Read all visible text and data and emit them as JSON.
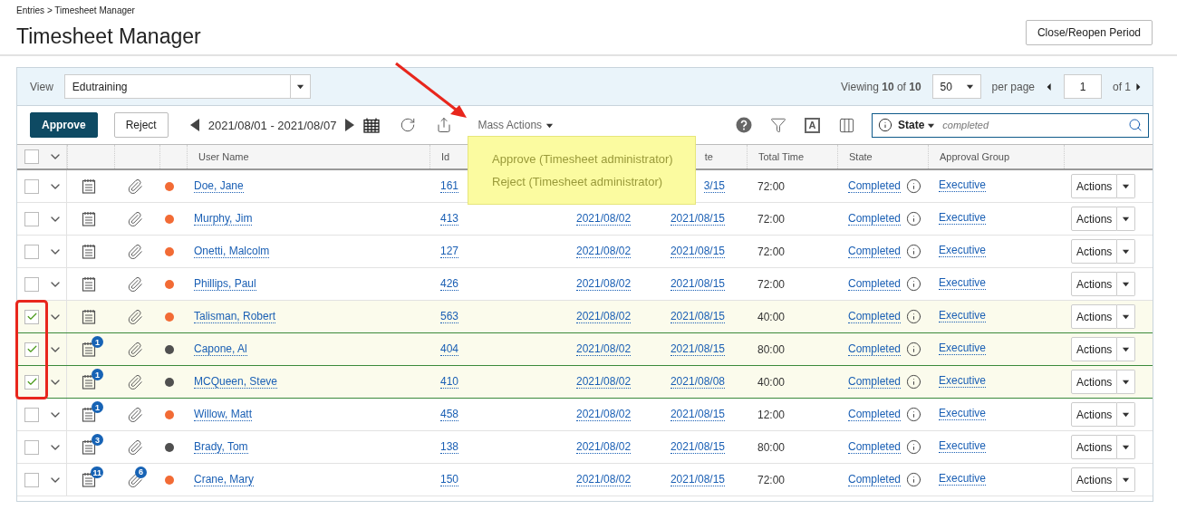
{
  "breadcrumb": "Entries > Timesheet Manager",
  "title": "Timesheet Manager",
  "close_button": "Close/Reopen Period",
  "view": {
    "label": "View",
    "value": "Edutraining"
  },
  "paging": {
    "viewing": "Viewing **10** of **10**",
    "page_size": "50",
    "per_page": "per page",
    "page": "1",
    "of": "of 1"
  },
  "toolbar": {
    "approve": "Approve",
    "reject": "Reject",
    "date_range": "2021/08/01 - 2021/08/07",
    "mass_actions": "Mass Actions",
    "text_icon": "A"
  },
  "search": {
    "field": "State",
    "placeholder": "completed"
  },
  "mass_actions_menu": [
    "Approve (Timesheet administrator)",
    "Reject (Timesheet administrator)"
  ],
  "select_all": {
    "checked": false
  },
  "columns": [
    "User Name",
    "Id",
    "",
    "te",
    "Total Time",
    "State",
    "Approval Group"
  ],
  "rows": [
    {
      "checked": false,
      "notes_badge": "",
      "attach_badge": "",
      "color": "#f26b35",
      "user": "Doe, Jane",
      "id": "161",
      "start": "",
      "end": "3/15",
      "total": "72:00",
      "state": "Completed",
      "group": "Executive",
      "actions": "Actions"
    },
    {
      "checked": false,
      "notes_badge": "",
      "attach_badge": "",
      "color": "#f26b35",
      "user": "Murphy, Jim",
      "id": "413",
      "start": "2021/08/02",
      "end": "2021/08/15",
      "total": "72:00",
      "state": "Completed",
      "group": "Executive",
      "actions": "Actions"
    },
    {
      "checked": false,
      "notes_badge": "",
      "attach_badge": "",
      "color": "#f26b35",
      "user": "Onetti, Malcolm",
      "id": "127",
      "start": "2021/08/02",
      "end": "2021/08/15",
      "total": "72:00",
      "state": "Completed",
      "group": "Executive",
      "actions": "Actions"
    },
    {
      "checked": false,
      "notes_badge": "",
      "attach_badge": "",
      "color": "#f26b35",
      "user": "Phillips, Paul",
      "id": "426",
      "start": "2021/08/02",
      "end": "2021/08/15",
      "total": "72:00",
      "state": "Completed",
      "group": "Executive",
      "actions": "Actions"
    },
    {
      "checked": true,
      "notes_badge": "",
      "attach_badge": "",
      "color": "#f26b35",
      "user": "Talisman, Robert",
      "id": "563",
      "start": "2021/08/02",
      "end": "2021/08/15",
      "total": "40:00",
      "state": "Completed",
      "group": "Executive",
      "actions": "Actions"
    },
    {
      "checked": true,
      "notes_badge": "1",
      "attach_badge": "",
      "color": "#505050",
      "user": "Capone, Al",
      "id": "404",
      "start": "2021/08/02",
      "end": "2021/08/15",
      "total": "80:00",
      "state": "Completed",
      "group": "Executive",
      "actions": "Actions"
    },
    {
      "checked": true,
      "notes_badge": "1",
      "attach_badge": "",
      "color": "#505050",
      "user": "MCQueen, Steve",
      "id": "410",
      "start": "2021/08/02",
      "end": "2021/08/08",
      "total": "40:00",
      "state": "Completed",
      "group": "Executive",
      "actions": "Actions"
    },
    {
      "checked": false,
      "notes_badge": "1",
      "attach_badge": "",
      "color": "#f26b35",
      "user": "Willow, Matt",
      "id": "458",
      "start": "2021/08/02",
      "end": "2021/08/15",
      "total": "12:00",
      "state": "Completed",
      "group": "Executive",
      "actions": "Actions"
    },
    {
      "checked": false,
      "notes_badge": "3",
      "attach_badge": "",
      "color": "#505050",
      "user": "Brady, Tom",
      "id": "138",
      "start": "2021/08/02",
      "end": "2021/08/15",
      "total": "80:00",
      "state": "Completed",
      "group": "Executive",
      "actions": "Actions"
    },
    {
      "checked": false,
      "notes_badge": "11",
      "attach_badge": "6",
      "color": "#f26b35",
      "user": "Crane, Mary",
      "id": "150",
      "start": "2021/08/02",
      "end": "2021/08/15",
      "total": "72:00",
      "state": "Completed",
      "group": "Executive",
      "actions": "Actions"
    }
  ]
}
